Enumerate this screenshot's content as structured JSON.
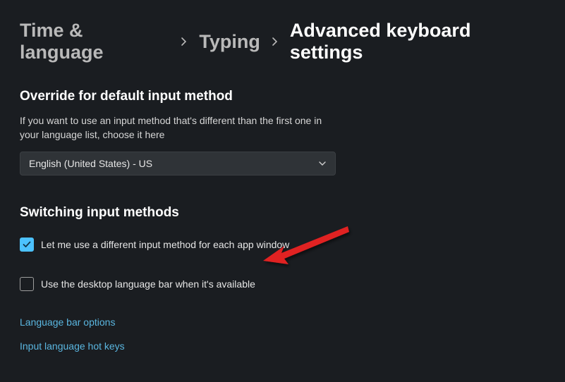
{
  "breadcrumb": {
    "level1": "Time & language",
    "level2": "Typing",
    "current": "Advanced keyboard settings"
  },
  "section1": {
    "title": "Override for default input method",
    "description": "If you want to use an input method that's different than the first one in your language list, choose it here",
    "dropdown_value": "English (United States) - US"
  },
  "section2": {
    "title": "Switching input methods",
    "checkbox1": {
      "label": "Let me use a different input method for each app window",
      "checked": true
    },
    "checkbox2": {
      "label": "Use the desktop language bar when it's available",
      "checked": false
    }
  },
  "links": {
    "language_bar": "Language bar options",
    "hotkeys": "Input language hot keys"
  }
}
